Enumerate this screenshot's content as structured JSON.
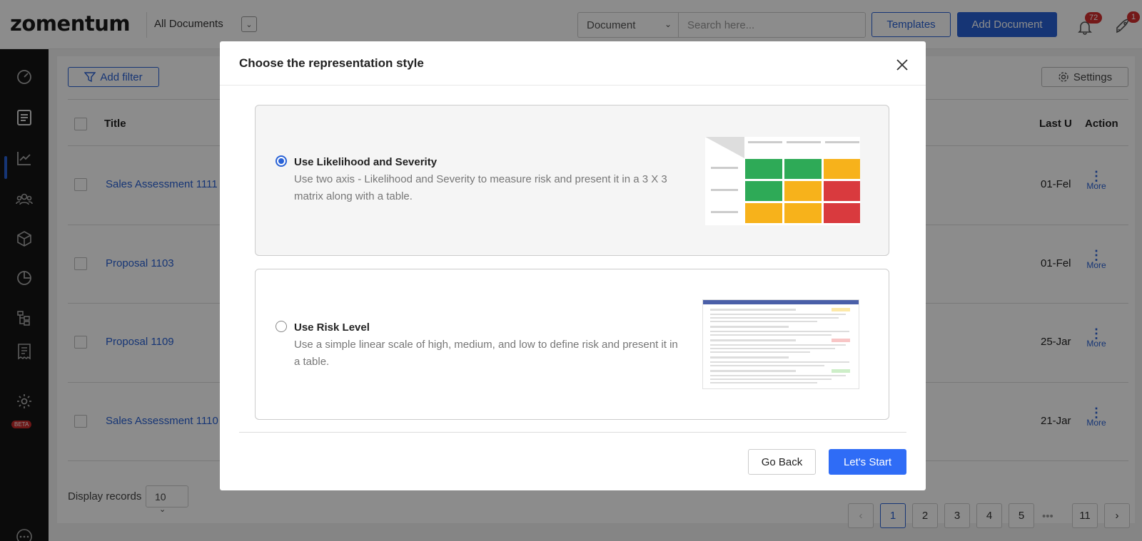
{
  "header": {
    "logo": "zomentum",
    "view": "All Documents",
    "doc_type": "Document",
    "search_placeholder": "Search here...",
    "templates_label": "Templates",
    "add_document_label": "Add Document",
    "notifications_count": "72",
    "rocket_count": "1"
  },
  "sidebar": {
    "items": [
      "dashboard-icon",
      "documents-icon",
      "analytics-icon",
      "clients-icon",
      "products-icon",
      "reports-icon",
      "workflow-icon",
      "forms-icon",
      "settings-icon"
    ],
    "beta_label": "BETA",
    "active_color": "#2962d6"
  },
  "toolbar": {
    "add_filter_label": "Add filter",
    "settings_label": "Settings"
  },
  "table": {
    "headers": {
      "title": "Title",
      "last_updated": "Last U",
      "action": "Action"
    },
    "rows": [
      {
        "title": "Sales Assessment 1111",
        "date": "01-Fel",
        "action": "More"
      },
      {
        "title": "Proposal 1103",
        "date": "01-Fel",
        "action": "More"
      },
      {
        "title": "Proposal 1109",
        "date": "25-Jar",
        "action": "More"
      },
      {
        "title": "Sales Assessment 1110",
        "date": "21-Jar",
        "action": "More"
      }
    ]
  },
  "pagination": {
    "display_label": "Display records",
    "page_size": "10",
    "pages": [
      "1",
      "2",
      "3",
      "4",
      "5",
      "11"
    ],
    "current": "1",
    "ellipsis": "•••"
  },
  "modal": {
    "title": "Choose the representation style",
    "options": [
      {
        "title": "Use Likelihood and Severity",
        "description": "Use two axis - Likelihood and Severity to measure risk and present it in a 3 X 3 matrix along with a table.",
        "selected": true
      },
      {
        "title": "Use Risk Level",
        "description": "Use a simple linear scale of high, medium, and low to define risk and present it in a table.",
        "selected": false
      }
    ],
    "back_label": "Go Back",
    "start_label": "Let's Start",
    "matrix_colors": [
      "#2eaa57",
      "#2eaa57",
      "#f7b21b",
      "#2eaa57",
      "#f7b21b",
      "#d93a3e",
      "#f7b21b",
      "#f7b21b",
      "#d93a3e"
    ]
  }
}
